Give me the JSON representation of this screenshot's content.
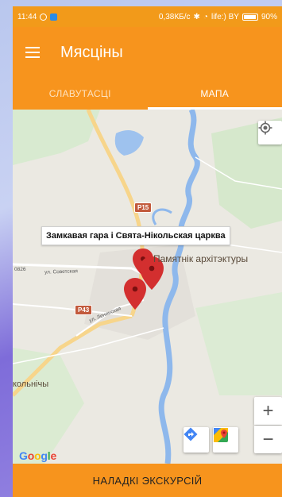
{
  "status_bar": {
    "time": "11:44",
    "network_speed": "0,38КБ/с",
    "carrier": "life:) BY",
    "battery": "90%"
  },
  "app_bar": {
    "title": "Мясціны",
    "menu_icon": "hamburger-menu-icon"
  },
  "tabs": [
    {
      "label": "СЛАВУТАСЦІ",
      "active": false
    },
    {
      "label": "МАПА",
      "active": true
    }
  ],
  "map": {
    "info_window_title": "Замкавая гара і Свята-Нікольская царква",
    "labels": {
      "monument": "Памятнік архітэктуры",
      "village": "кольнічы",
      "street_sovetskaya": "ул. Советская",
      "street_leninskaya": "ул. Ленинская",
      "road_number": "0826"
    },
    "road_shields": [
      "P15",
      "P43"
    ],
    "controls": {
      "locate_icon": "my-location-icon",
      "zoom_in": "+",
      "zoom_out": "−",
      "directions_icon": "directions-icon",
      "maps_icon": "google-maps-icon"
    },
    "attribution": "Google",
    "marker_color": "#d32f2f"
  },
  "bottom_bar": {
    "label": "НАЛАДКІ ЭКСКУРСІЙ"
  },
  "colors": {
    "accent": "#f7941d",
    "status": "#f29a1a"
  }
}
